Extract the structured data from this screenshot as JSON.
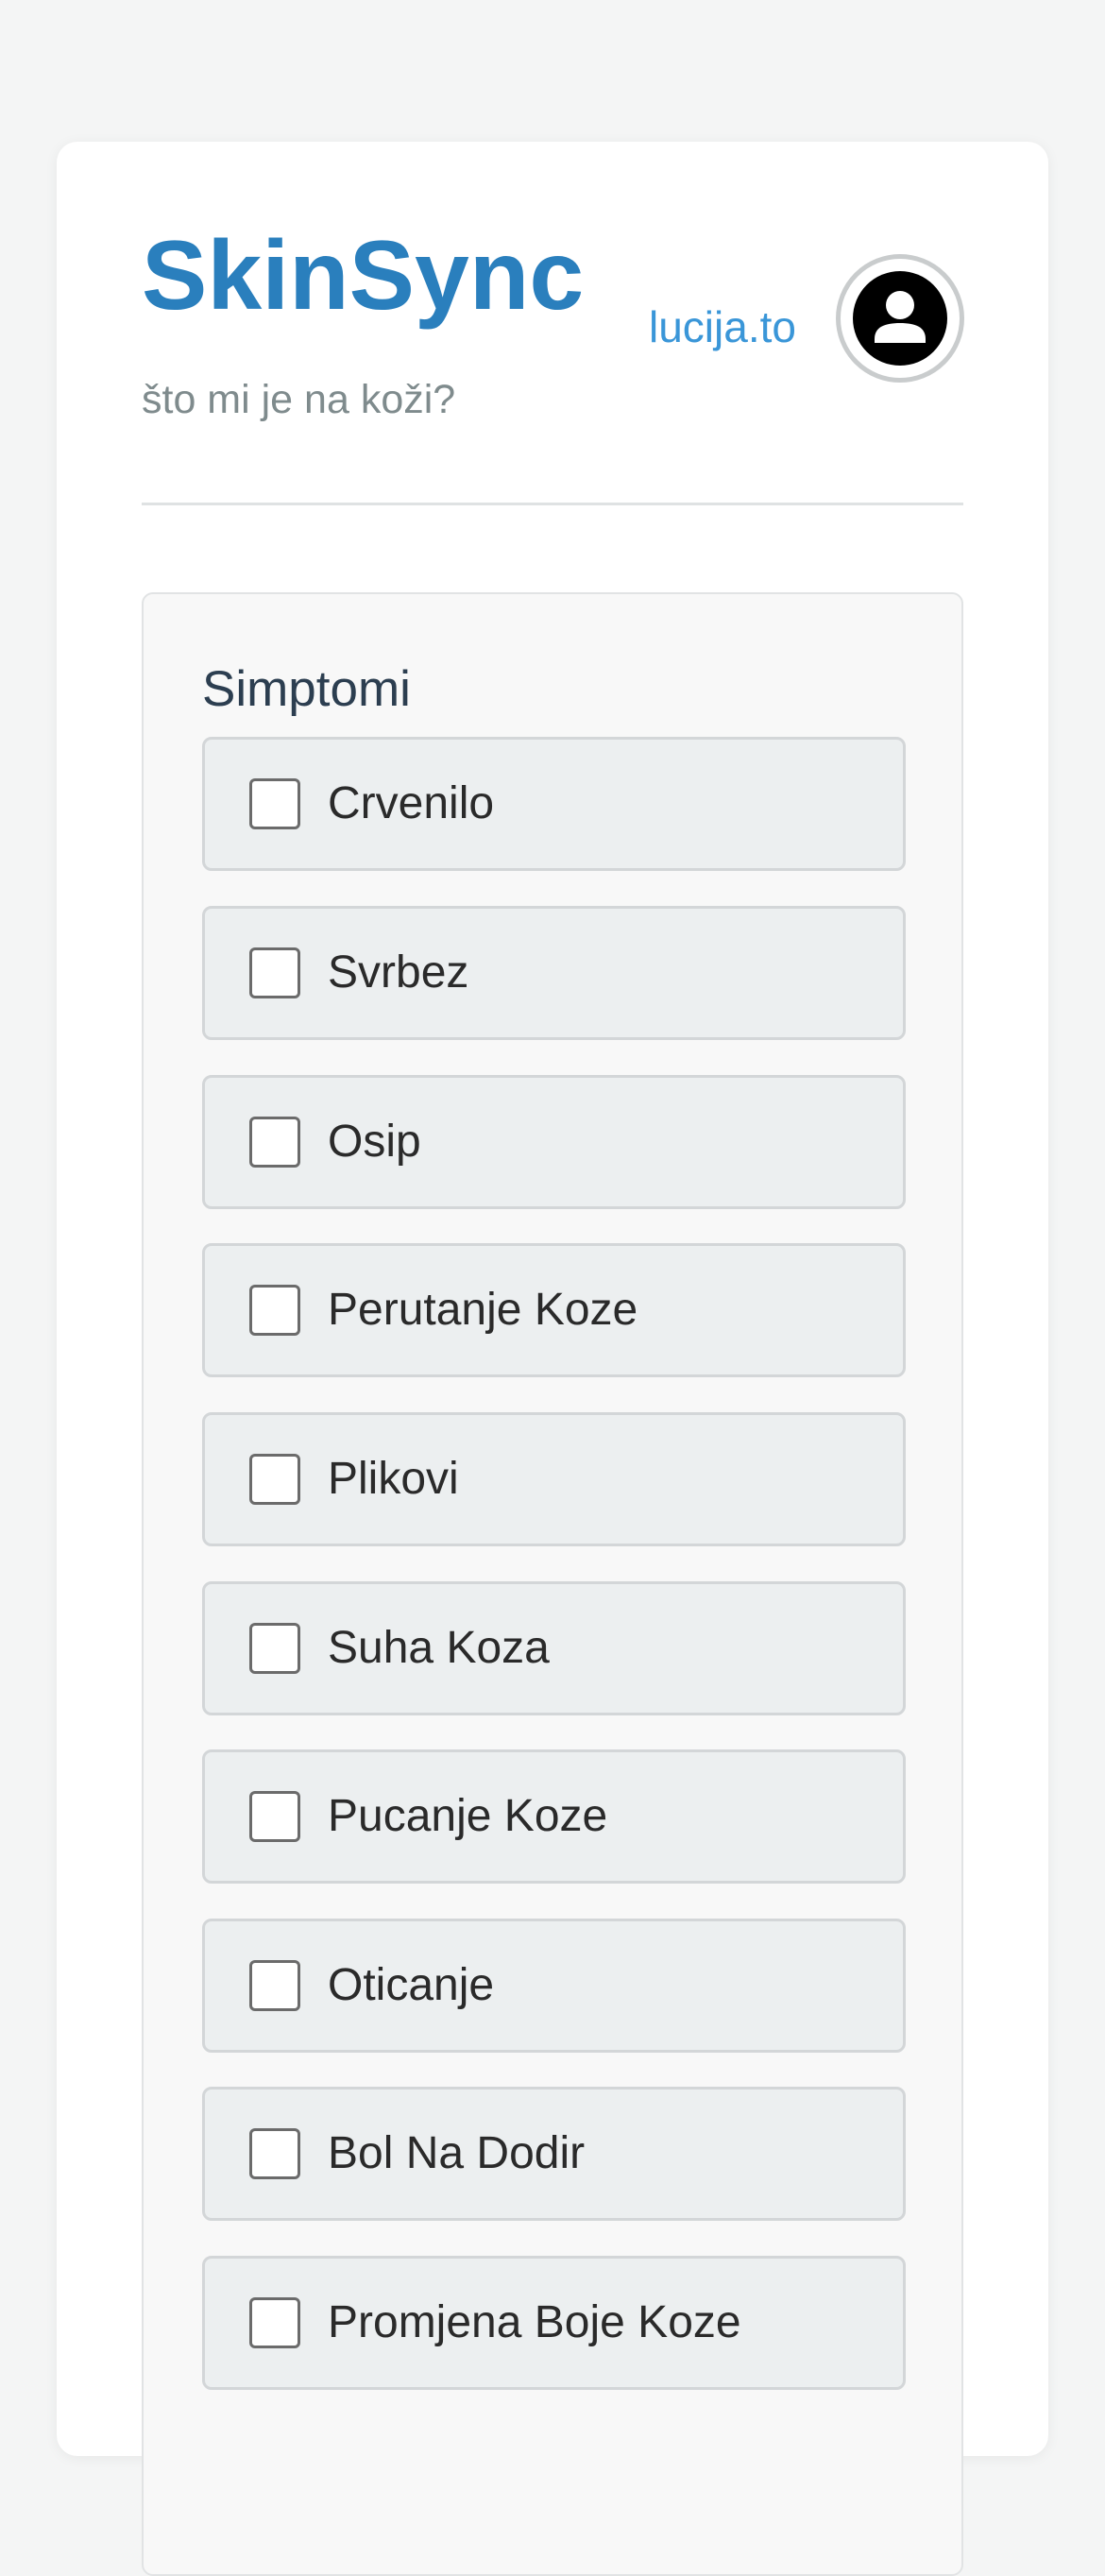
{
  "app": {
    "title": "SkinSync",
    "subtitle": "što mi je na koži?",
    "username": "lucija.to",
    "accent_color": "#2a7fbd",
    "link_color": "#3a96d8",
    "avatar_icon": "user-icon"
  },
  "symptoms": {
    "title": "Simptomi",
    "items": [
      {
        "label": "Crvenilo",
        "checked": false
      },
      {
        "label": "Svrbez",
        "checked": false
      },
      {
        "label": "Osip",
        "checked": false
      },
      {
        "label": "Perutanje Koze",
        "checked": false
      },
      {
        "label": "Plikovi",
        "checked": false
      },
      {
        "label": "Suha Koza",
        "checked": false
      },
      {
        "label": "Pucanje Koze",
        "checked": false
      },
      {
        "label": "Oticanje",
        "checked": false
      },
      {
        "label": "Bol Na Dodir",
        "checked": false
      },
      {
        "label": "Promjena Boje Koze",
        "checked": false
      }
    ]
  }
}
